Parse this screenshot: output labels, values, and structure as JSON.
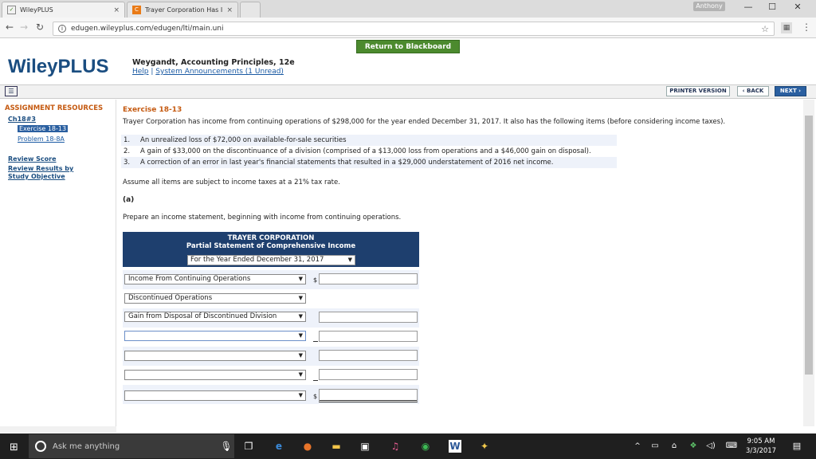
{
  "browser": {
    "tabs": [
      {
        "label": "WileyPLUS",
        "close": "×"
      },
      {
        "label": "Trayer Corporation Has I",
        "close": "×"
      }
    ],
    "user": "Anthony",
    "url": "edugen.wileyplus.com/edugen/lti/main.uni",
    "window_controls": [
      "—",
      "☐",
      "✕"
    ]
  },
  "header": {
    "return_button": "Return to Blackboard",
    "logo": "WileyPLUS",
    "course_title": "Weygandt, Accounting Principles, 12e",
    "help": "Help",
    "separator": " | ",
    "announcements": "System Announcements (1 Unread)"
  },
  "toolbar": {
    "printer": "PRINTER VERSION",
    "back": "‹ BACK",
    "next": "NEXT ›"
  },
  "sidebar": {
    "header": "ASSIGNMENT RESOURCES",
    "chapter": "Ch18#3",
    "active": "Exercise 18-13",
    "problem": "Problem 18-8A",
    "review_score": "Review Score",
    "review_results": "Review Results by Study Objective"
  },
  "exercise": {
    "title": "Exercise 18-13",
    "intro": "Trayer Corporation has income from continuing operations of $298,000 for the year ended December 31, 2017. It also has the following items (before considering income taxes).",
    "items": [
      {
        "num": "1.",
        "text": "An unrealized loss of $72,000 on available-for-sale securities"
      },
      {
        "num": "2.",
        "text": "A gain of $33,000 on the discontinuance of a division (comprised of a $13,000 loss from operations and a $46,000 gain on disposal)."
      },
      {
        "num": "3.",
        "text": "A correction of an error in last year's financial statements that resulted in a $29,000 understatement of 2016 net income."
      }
    ],
    "assume": "Assume all items are subject to income taxes at a 21% tax rate.",
    "part": "(a)",
    "prepare": "Prepare an income statement, beginning with income from continuing operations."
  },
  "statement": {
    "company": "TRAYER CORPORATION",
    "name": "Partial Statement of Comprehensive Income",
    "period": "For the Year Ended December 31, 2017",
    "rows": [
      {
        "label": "Income From Continuing Operations",
        "dollar": "$"
      },
      {
        "label": "Discontinued Operations",
        "dollar": ""
      },
      {
        "label": "Gain from Disposal of Discontinued Division",
        "dollar": ""
      },
      {
        "label": "",
        "dollar": ""
      },
      {
        "label": "",
        "dollar": ""
      },
      {
        "label": "",
        "dollar": ""
      },
      {
        "label": "",
        "dollar": "$"
      }
    ]
  },
  "taskbar": {
    "search": "Ask me anything",
    "time": "9:05 AM",
    "date": "3/3/2017"
  }
}
